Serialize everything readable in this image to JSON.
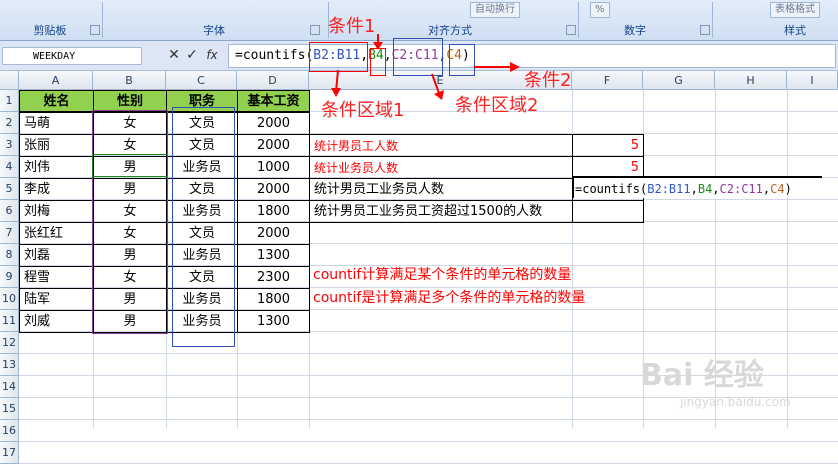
{
  "ribbon": {
    "groups": [
      "剪贴板",
      "字体",
      "对齐方式",
      "数字",
      "样式"
    ],
    "btn_wrap": "自动换行",
    "btn_format": "表格格式",
    "btn_percent": "%"
  },
  "formula_bar": {
    "name_box": "WEEKDAY",
    "cancel": "✕",
    "enter": "✓",
    "fx": "fx",
    "formula": {
      "p1": "=countifs(",
      "p2": "B2:B11",
      "p3": ",",
      "p4": "B4",
      "p5": ",",
      "p6": "C2:C11",
      "p7": ",",
      "p8": "C4",
      "p9": ")"
    }
  },
  "columns": [
    "A",
    "B",
    "C",
    "D",
    "E",
    "F",
    "G",
    "H",
    "I"
  ],
  "rows": [
    "1",
    "2",
    "3",
    "4",
    "5",
    "6",
    "7",
    "8",
    "9",
    "10",
    "11",
    "12",
    "13",
    "14",
    "15",
    "16",
    "17"
  ],
  "table": {
    "headers": [
      "姓名",
      "性别",
      "职务",
      "基本工资"
    ],
    "rows": [
      [
        "马萌",
        "女",
        "文员",
        "2000"
      ],
      [
        "张丽",
        "女",
        "文员",
        "2000"
      ],
      [
        "刘伟",
        "男",
        "业务员",
        "1000"
      ],
      [
        "李成",
        "男",
        "文员",
        "2000"
      ],
      [
        "刘梅",
        "女",
        "业务员",
        "1800"
      ],
      [
        "张红红",
        "女",
        "文员",
        "2000"
      ],
      [
        "刘磊",
        "男",
        "业务员",
        "1300"
      ],
      [
        "程雪",
        "女",
        "文员",
        "2300"
      ],
      [
        "陆军",
        "男",
        "业务员",
        "1800"
      ],
      [
        "刘威",
        "男",
        "业务员",
        "1300"
      ]
    ]
  },
  "stats": {
    "rows": [
      {
        "label": "统计男员工人数",
        "value": "5"
      },
      {
        "label": "统计业务员人数",
        "value": "5"
      },
      {
        "label": "统计男员工业务员人数",
        "value": ""
      },
      {
        "label": "统计男员工业务员工资超过1500的人数",
        "value": ""
      }
    ],
    "editing": {
      "p1": "=countifs(",
      "p2": "B2:B11",
      "p3": ",",
      "p4": "B4",
      "p5": ",",
      "p6": "C2:C11",
      "p7": ",",
      "p8": "C4",
      "p9": ")"
    }
  },
  "notes": {
    "line1": "countif计算满足某个条件的单元格的数量",
    "line2": "countif是计算满足多个条件的单元格的数量"
  },
  "annotations": {
    "cond1": "条件1",
    "cond2": "条件2",
    "range1": "条件区域1",
    "range2": "条件区域2"
  },
  "watermark": {
    "text": "Bai 经验",
    "sub": "jingyan.baidu.com"
  },
  "colors": {
    "header_fill": "#92d050",
    "annotation": "#ff0000",
    "range1_box": "#8b3a9e",
    "range2_box": "#2f4fb5"
  }
}
